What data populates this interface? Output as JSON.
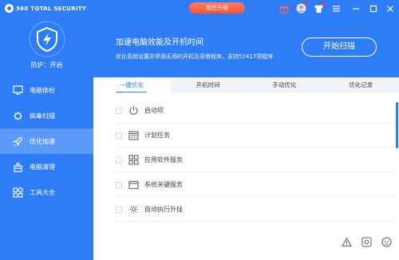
{
  "app": {
    "logo_text": "360 TOTAL SECURITY"
  },
  "titlebar": {
    "upgrade_label": "现在升级"
  },
  "sidebar": {
    "protect_label": "防护：开启",
    "items": [
      {
        "label": "电脑体检",
        "icon": "monitor-icon"
      },
      {
        "label": "病毒扫描",
        "icon": "virus-scan-icon"
      },
      {
        "label": "优化加速",
        "icon": "rocket-icon",
        "active": true
      },
      {
        "label": "电脑清理",
        "icon": "broom-icon"
      },
      {
        "label": "工具大全",
        "icon": "tools-grid-icon"
      }
    ]
  },
  "banner": {
    "title": "加速电脑效能及开机时间",
    "subtitle": "优化系统设置并停用无用的开机及背景程序。支持52417项程序",
    "scan_label": "开始扫描"
  },
  "tabs": [
    "一键优化",
    "开机时间",
    "手动优化",
    "优化记录"
  ],
  "active_tab": 0,
  "list": [
    {
      "label": "启动项",
      "icon": "power-icon"
    },
    {
      "label": "计划任务",
      "icon": "calendar-icon"
    },
    {
      "label": "应用软件服务",
      "icon": "app-grid-icon"
    },
    {
      "label": "系统关键服务",
      "icon": "window-icon"
    },
    {
      "label": "自动执行外挂",
      "icon": "gear-refresh-icon"
    }
  ],
  "colors": {
    "accent": "#2e7cf6",
    "active_nav": "#5b9af8",
    "upgrade": "#f4553a"
  }
}
